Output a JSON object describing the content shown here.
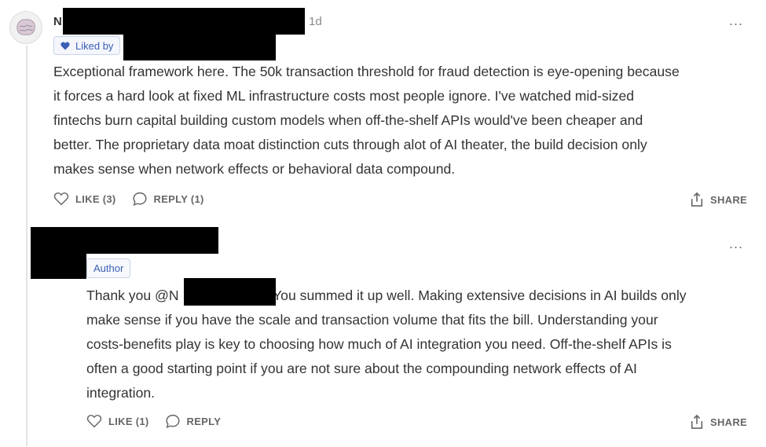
{
  "comment": {
    "author_initial": "N",
    "time": "1d",
    "liked_by_label": "Liked by",
    "paragraph_lines": [
      "Exceptional framework here. The 50k transaction threshold for fraud detection is eye-opening because",
      "it forces a hard look at fixed ML infrastructure costs most people ignore. I've watched mid-sized",
      "fintechs burn capital building custom models when off-the-shelf APIs would've been cheaper and",
      "better. The proprietary data moat distinction cuts through alot of AI theater, the build decision only",
      "makes sense when network effects or behavioral data compound."
    ],
    "like_label": "LIKE (3)",
    "reply_label": "REPLY (1)",
    "share_label": "SHARE",
    "more_label": "..."
  },
  "reply": {
    "author_badge": "Author",
    "paragraph_lines": [
      "Thank you @N",
      "! You summed it up well. Making extensive decisions in AI builds only",
      "make sense if you have the scale and transaction volume that fits the bill. Understanding your",
      "costs-benefits play is key to choosing how much of AI integration you need. Off-the-shelf APIs is",
      "often a good starting point if you are not sure about the compounding network effects of AI",
      "integration."
    ],
    "like_label": "LIKE (1)",
    "reply_label": "REPLY",
    "share_label": "SHARE",
    "more_label": "..."
  },
  "icons": {
    "heart": "heart-icon",
    "comment": "comment-icon",
    "share": "share-icon",
    "more": "more-icon",
    "avatar": "avatar"
  },
  "colors": {
    "accent": "#3b5fb5",
    "text": "#333333",
    "muted": "#666666",
    "redaction": "#000000"
  }
}
